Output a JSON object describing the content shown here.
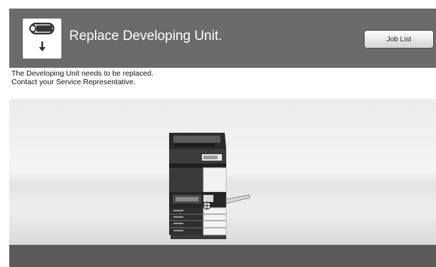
{
  "header": {
    "title": "Replace Developing Unit.",
    "icon": "developing-unit-replace-icon",
    "job_list_label": "Job List"
  },
  "message": {
    "line1": "The Developing Unit needs to be replaced.",
    "line2": "Contact your Service Representative."
  },
  "illustration": {
    "icon": "copier-machine-illustration",
    "highlight": "developing-unit-location-marker"
  },
  "colors": {
    "frame": "#565656",
    "header_bg": "#6b6b6b",
    "message_bg": "#ffffff",
    "button_bg": "#f0f0f0"
  }
}
